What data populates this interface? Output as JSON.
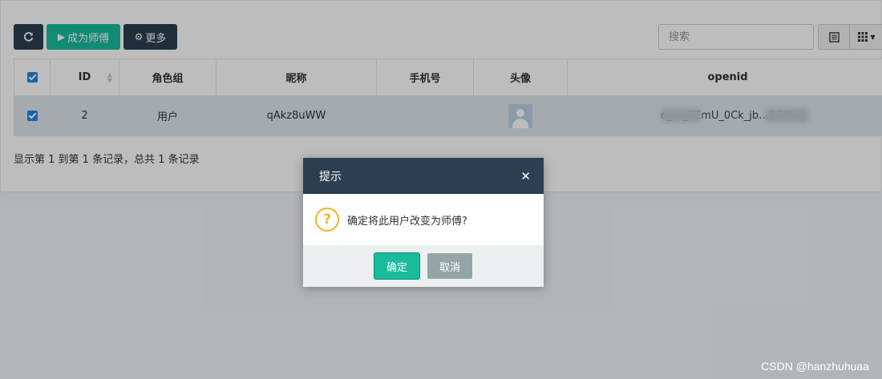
{
  "toolbar": {
    "refresh_icon": "refresh-icon",
    "master_label": "成为师傅",
    "master_icon": "play-icon",
    "more_label": "更多",
    "more_icon": "gear-icon",
    "search_placeholder": "搜索",
    "view_list_icon": "list-icon",
    "view_columns_icon": "grid-icon"
  },
  "table": {
    "headers": [
      "ID",
      "角色组",
      "昵称",
      "手机号",
      "头像",
      "openid"
    ],
    "rows": [
      {
        "checked": true,
        "id": "2",
        "group": "用户",
        "nickname": "qAkz8uWW",
        "mobile": "",
        "avatar": "avatar-icon",
        "openid": "o_…_EEmU_0Ck_jb…SGfC"
      }
    ]
  },
  "summary": "显示第 1 到第 1 条记录，总共 1 条记录",
  "dialog": {
    "title": "提示",
    "message": "确定将此用户改变为师傅?",
    "ok_label": "确定",
    "cancel_label": "取消",
    "accent_color": "#18bc9c",
    "header_color": "#2c3e50"
  },
  "watermark": "CSDN @hanzhuhuaa"
}
